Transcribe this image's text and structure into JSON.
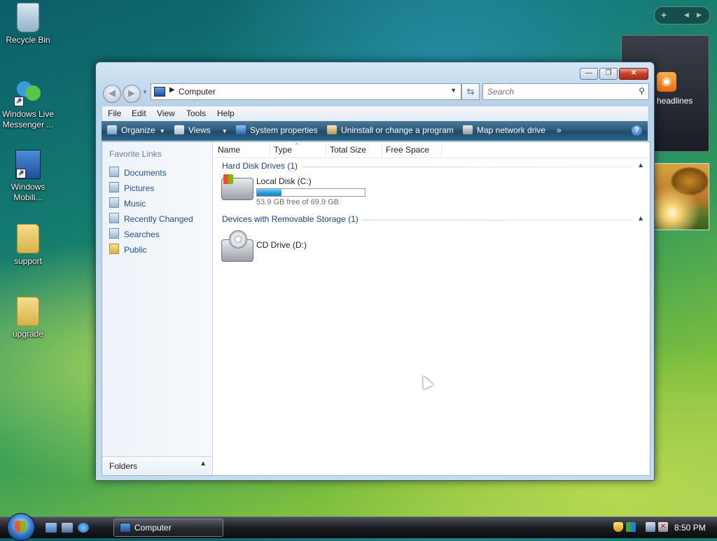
{
  "desktop": {
    "icons": [
      {
        "label": "Recycle Bin"
      },
      {
        "label": "Windows Live Messenger ..."
      },
      {
        "label": "Windows Mobili..."
      },
      {
        "label": "support"
      },
      {
        "label": "upgrade"
      }
    ],
    "gadgets": {
      "feed_label": "headlines"
    }
  },
  "window": {
    "caption": {
      "minimize": "—",
      "maximize": "❐",
      "close": "✕"
    },
    "address": {
      "location": "Computer"
    },
    "search": {
      "placeholder": "Search"
    },
    "menu": [
      "File",
      "Edit",
      "View",
      "Tools",
      "Help"
    ],
    "commands": [
      "Organize",
      "Views",
      "System properties",
      "Uninstall or change a program",
      "Map network drive",
      "»"
    ],
    "help": "?",
    "favorite_links": {
      "title": "Favorite Links",
      "items": [
        "Documents",
        "Pictures",
        "Music",
        "Recently Changed",
        "Searches",
        "Public"
      ]
    },
    "folders_label": "Folders",
    "columns": [
      "Name",
      "Type",
      "Total Size",
      "Free Space"
    ],
    "groups": [
      {
        "title": "Hard Disk Drives (1)",
        "items": [
          {
            "name": "Local Disk (C:)",
            "free_text": "53.9 GB free of 69.9 GB",
            "used_fraction": 0.229
          }
        ]
      },
      {
        "title": "Devices with Removable Storage (1)",
        "items": [
          {
            "name": "CD Drive (D:)"
          }
        ]
      }
    ]
  },
  "taskbar": {
    "task": "Computer",
    "clock": "8:50 PM"
  },
  "colors": {
    "accent": "#1a4e9c",
    "group_text": "#1b3f8f",
    "usage_fill": "#26a0da"
  }
}
